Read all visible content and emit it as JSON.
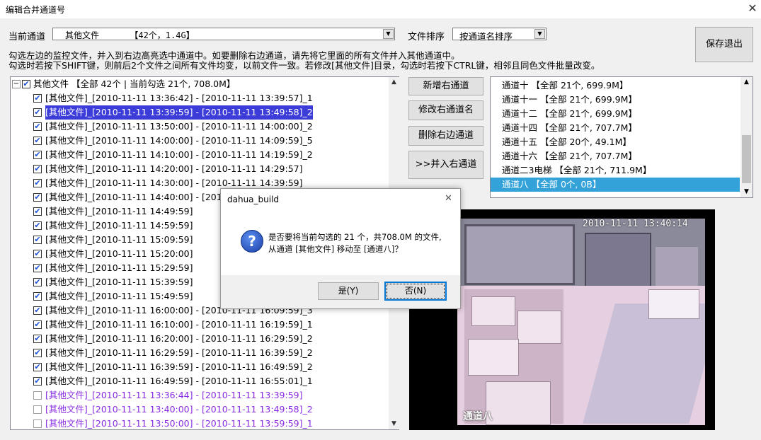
{
  "window": {
    "title": "编辑合并通道号",
    "close_glyph": "✕"
  },
  "toolbar": {
    "current_channel_label": "当前通道",
    "current_channel_value": "其他文件      【42个，1.4G】",
    "sort_label": "文件排序",
    "sort_value": "按通道名排序",
    "save_exit_label": "保存退出"
  },
  "hints": {
    "line1": "勾选左边的监控文件，并入到右边高亮选中通道中。如要删除右边通道，请先将它里面的所有文件并入其他通道中。",
    "line2": "勾选时若按下SHIFT键，则前后2个文件之间所有文件均变，以前文件一致。若修改[其他文件]目录，勾选时若按下CTRL键，相邻且同色文件批量改变。"
  },
  "tree": {
    "root": {
      "toggle": "−",
      "label": "其他文件 【全部 42个 | 当前勾选 21个, 708.0M】",
      "checked": true
    },
    "items": [
      {
        "label": "[其他文件]_[2010-11-11 13:36:42] - [2010-11-11 13:39:57]_1",
        "checked": true,
        "style": "normal"
      },
      {
        "label": "[其他文件]_[2010-11-11 13:39:59] - [2010-11-11 13:49:58]_2",
        "checked": true,
        "style": "selected"
      },
      {
        "label": "[其他文件]_[2010-11-11 13:50:00] - [2010-11-11 14:00:00]_2",
        "checked": true,
        "style": "normal"
      },
      {
        "label": "[其他文件]_[2010-11-11 14:00:00] - [2010-11-11 14:09:59]_5",
        "checked": true,
        "style": "normal"
      },
      {
        "label": "[其他文件]_[2010-11-11 14:10:00] - [2010-11-11 14:19:59]_2",
        "checked": true,
        "style": "normal"
      },
      {
        "label": "[其他文件]_[2010-11-11 14:20:00] - [2010-11-11 14:29:57]",
        "checked": true,
        "style": "normal"
      },
      {
        "label": "[其他文件]_[2010-11-11 14:30:00] - [2010-11-11 14:39:59]",
        "checked": true,
        "style": "normal"
      },
      {
        "label": "[其他文件]_[2010-11-11 14:40:00] - [2010-11-11 14:49:59]",
        "checked": true,
        "style": "normal"
      },
      {
        "label": "[其他文件]_[2010-11-11 14:49:59]",
        "checked": true,
        "style": "normal"
      },
      {
        "label": "[其他文件]_[2010-11-11 14:59:59]",
        "checked": true,
        "style": "normal"
      },
      {
        "label": "[其他文件]_[2010-11-11 15:09:59]",
        "checked": true,
        "style": "normal"
      },
      {
        "label": "[其他文件]_[2010-11-11 15:20:00]",
        "checked": true,
        "style": "normal"
      },
      {
        "label": "[其他文件]_[2010-11-11 15:29:59]",
        "checked": true,
        "style": "normal"
      },
      {
        "label": "[其他文件]_[2010-11-11 15:39:59]",
        "checked": true,
        "style": "normal"
      },
      {
        "label": "[其他文件]_[2010-11-11 15:49:59]",
        "checked": true,
        "style": "normal"
      },
      {
        "label": "[其他文件]_[2010-11-11 16:00:00] - [2010-11-11 16:09:59]_3",
        "checked": true,
        "style": "normal"
      },
      {
        "label": "[其他文件]_[2010-11-11 16:10:00] - [2010-11-11 16:19:59]_1",
        "checked": true,
        "style": "normal"
      },
      {
        "label": "[其他文件]_[2010-11-11 16:20:00] - [2010-11-11 16:29:59]_2",
        "checked": true,
        "style": "normal"
      },
      {
        "label": "[其他文件]_[2010-11-11 16:29:59] - [2010-11-11 16:39:59]_2",
        "checked": true,
        "style": "normal"
      },
      {
        "label": "[其他文件]_[2010-11-11 16:39:59] - [2010-11-11 16:49:59]_2",
        "checked": true,
        "style": "normal"
      },
      {
        "label": "[其他文件]_[2010-11-11 16:49:59] - [2010-11-11 16:55:01]_1",
        "checked": true,
        "style": "normal"
      },
      {
        "label": "[其他文件]_[2010-11-11 13:36:44] - [2010-11-11 13:39:59]",
        "checked": false,
        "style": "purple"
      },
      {
        "label": "[其他文件]_[2010-11-11 13:40:00] - [2010-11-11 13:49:58]_2",
        "checked": false,
        "style": "purple"
      },
      {
        "label": "[其他文件]_[2010-11-11 13:50:00] - [2010-11-11 13:59:59]_1",
        "checked": false,
        "style": "purple"
      }
    ]
  },
  "actions": {
    "add_label": "新增右通道",
    "rename_label": "修改右通道名",
    "delete_label": "删除右边通道",
    "merge_label": ">>并入右通道"
  },
  "channels": {
    "items": [
      {
        "label": "通道十  【全部 21个, 699.9M】",
        "selected": false
      },
      {
        "label": "通道十一  【全部 21个, 699.9M】",
        "selected": false
      },
      {
        "label": "通道十二  【全部 21个, 699.9M】",
        "selected": false
      },
      {
        "label": "通道十四  【全部 21个, 707.7M】",
        "selected": false
      },
      {
        "label": "通道十五  【全部 20个, 49.1M】",
        "selected": false
      },
      {
        "label": "通道十六  【全部 21个, 707.7M】",
        "selected": false
      },
      {
        "label": "通道二3电梯  【全部 21个, 711.9M】",
        "selected": false
      },
      {
        "label": "通道八 【全部 0个, 0B】",
        "selected": true
      }
    ]
  },
  "preview": {
    "timestamp": "2010-11-11 13:40:14",
    "channel_caption": "通道八"
  },
  "dialog": {
    "title": "dahua_build",
    "close_glyph": "✕",
    "icon_glyph": "?",
    "message_line1": "是否要将当前勾选的 21 个，共708.0M 的文件,",
    "message_line2": "从通道 [其他文件] 移动至 [通道八]？",
    "yes_label": "是(Y)",
    "no_label": "否(N)"
  },
  "colors": {
    "selected_row": "#3c3cd8",
    "list_selection": "#33a2d8",
    "purple_text": "#8a2be2"
  }
}
